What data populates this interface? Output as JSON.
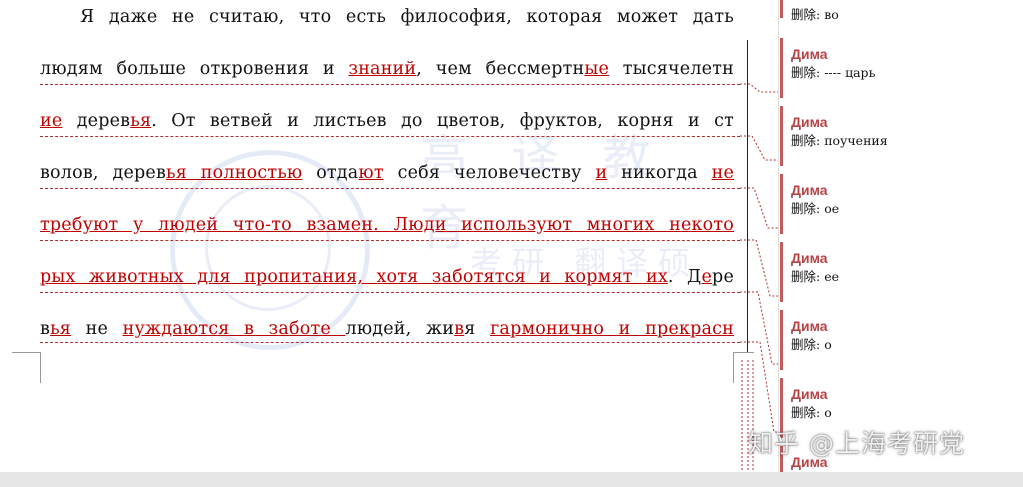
{
  "document": {
    "lines": [
      "Я даже не считаю, что есть философия, которая может дать",
      "людям больше откровения и знаний, чем бессмертные тысячелетн",
      "ие деревья. От ветвей и листьев до цветов, фруктов, корня и ст",
      "волов, деревья полностью отдают себя человечеству и никогда не",
      "требуют у людей что-то взамен. Люди используют многих некото",
      "рых животных для пропитания, хотя заботятся и кормят их. Дере",
      "вья не нуждаются в заботе людей, живя гармонично и прекрасн"
    ]
  },
  "comments": [
    {
      "author": "",
      "label": "删除:",
      "text": "во"
    },
    {
      "author": "Дима",
      "label": "删除:",
      "text": "---- царь"
    },
    {
      "author": "Дима",
      "label": "删除:",
      "text": "поучения"
    },
    {
      "author": "Дима",
      "label": "删除:",
      "text": "ое"
    },
    {
      "author": "Дима",
      "label": "删除:",
      "text": "ее"
    },
    {
      "author": "Дима",
      "label": "删除:",
      "text": "о"
    },
    {
      "author": "Дима",
      "label": "删除:",
      "text": "о"
    },
    {
      "author": "Дима",
      "label": "",
      "text": ""
    }
  ],
  "watermark": {
    "platform": "知乎 @上海考研党",
    "logo_chars": "高 译 教 育",
    "logo_sub": "考研 翻译硕"
  },
  "colors": {
    "revision": "#c00000",
    "comment_author": "#b84545",
    "comment_bar": "#c25b5b"
  }
}
